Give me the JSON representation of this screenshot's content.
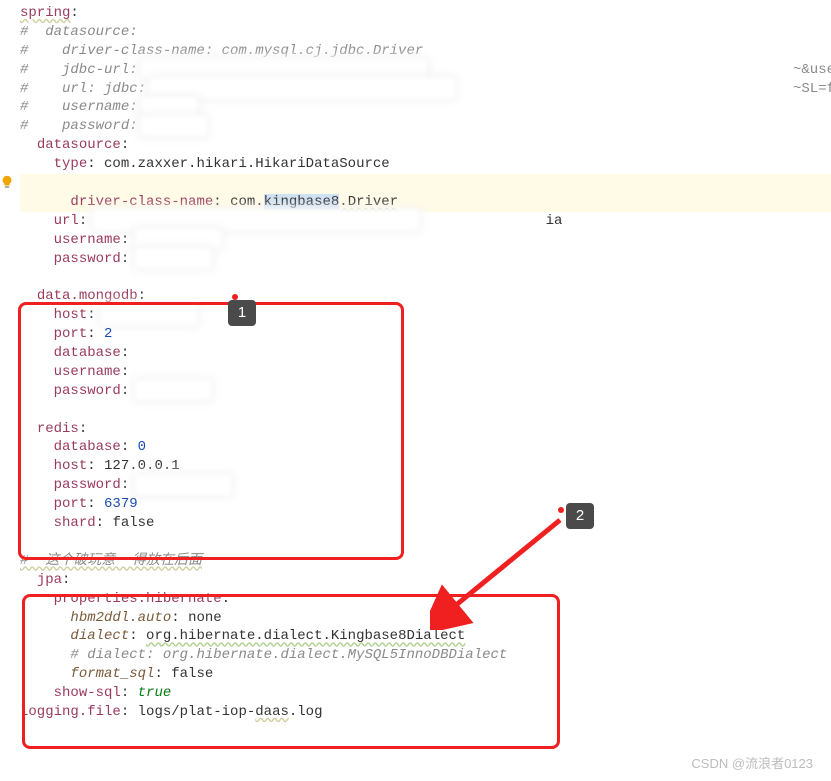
{
  "code": {
    "spring": "spring",
    "c_datasource": "#  datasource:",
    "c_driver": "#    driver-class-name: com.mysql.cj.jdbc.Driver",
    "c_jdbcurl": "#    jdbc-url:",
    "c_url": "#    url: jdbc:",
    "c_username": "#    username:",
    "c_password": "#    password:",
    "datasource": "datasource",
    "type_key": "type",
    "type_val": "com.zaxxer.hikari.HikariDataSource",
    "driver_key": "driver-class-name",
    "driver_pre": "com.",
    "driver_sel": "kingbase8",
    "driver_post": ".Driver",
    "url_key": "url",
    "url_hint": "ia",
    "username_key": "username",
    "password_key": "password",
    "mongo": "data.mongodb",
    "host_key": "host",
    "port_key": "port",
    "port_val": "2",
    "database_key": "database",
    "redis": "redis",
    "redis_db_val": "0",
    "redis_host_val": "127.0.0.1",
    "redis_port_val": "6379",
    "shard_key": "shard",
    "shard_val": "false",
    "comment_zh": "#  这个破玩意  得放在后面",
    "jpa": "jpa",
    "props_hib": "properties.hibernate",
    "hbm2ddl": "hbm2ddl.auto",
    "hbm2ddl_val": "none",
    "dialect": "dialect",
    "dialect_val": "org.hibernate.dialect.Kingbase8Dialect",
    "dialect_comment": "# dialect: org.hibernate.dialect.MySQL5InnoDBDialect",
    "format_sql": "format_sql",
    "format_sql_val": "false",
    "show_sql": "show-sql",
    "show_sql_val": "true",
    "logging_key": "logging.file",
    "logging_val1": "logs/plat-iop-",
    "logging_val2": "daas",
    "logging_val3": ".log",
    "right_hint1": "~&use",
    "right_hint2": "~SL=f"
  },
  "callouts": {
    "one": "1",
    "two": "2"
  },
  "watermark": "CSDN @流浪者0123"
}
